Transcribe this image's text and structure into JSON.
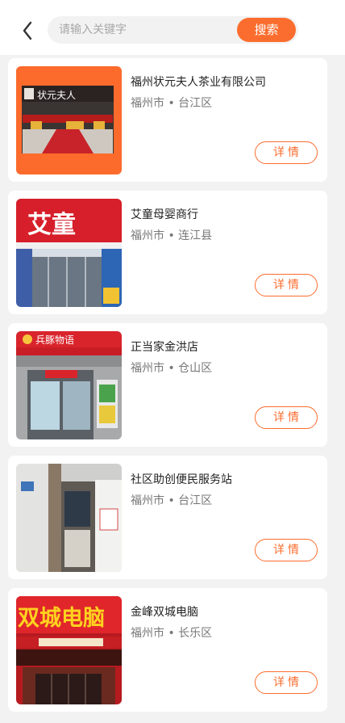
{
  "header": {
    "search_placeholder": "请输入关键字",
    "search_button": "搜索"
  },
  "shops": [
    {
      "name": "福州状元夫人茶业有限公司",
      "location": "福州市 • 台江区",
      "detail_label": "详情",
      "sign_text": "状元夫人"
    },
    {
      "name": "艾童母婴商行",
      "location": "福州市 • 连江县",
      "detail_label": "详情",
      "sign_text": "艾童"
    },
    {
      "name": "正当家金洪店",
      "location": "福州市 • 仓山区",
      "detail_label": "详情",
      "sign_text": "兵豚物语"
    },
    {
      "name": "社区助创便民服务站",
      "location": "福州市 • 台江区",
      "detail_label": "详情",
      "sign_text": ""
    },
    {
      "name": "金峰双城电脑",
      "location": "福州市 • 长乐区",
      "detail_label": "详情",
      "sign_text": "双城电脑"
    }
  ],
  "colors": {
    "accent": "#fb6d2e",
    "background": "#f2f2f2"
  }
}
